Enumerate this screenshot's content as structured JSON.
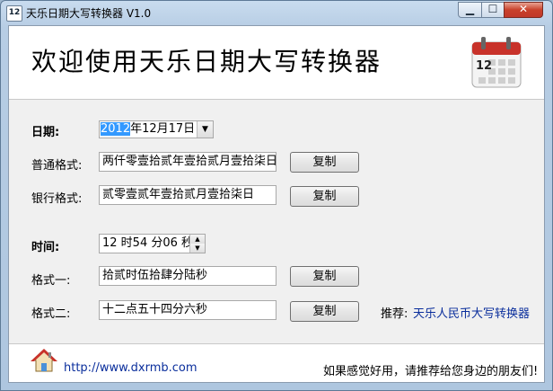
{
  "window": {
    "title": "天乐日期大写转换器 V1.0",
    "icon_text": "12",
    "min_icon": "minimize-icon",
    "max_icon": "maximize-icon",
    "close_icon": "close-icon"
  },
  "header": {
    "title": "欢迎使用天乐日期大写转换器",
    "calendar_icon": "calendar-icon",
    "calendar_number": "12"
  },
  "date_section": {
    "label": "日期:",
    "picker_year": "2012",
    "picker_rest": "年12月17日",
    "normal_label": "普通格式:",
    "normal_value": "两仟零壹拾贰年壹拾贰月壹拾柒日",
    "bank_label": "银行格式:",
    "bank_value": "贰零壹贰年壹拾贰月壹拾柒日",
    "copy_label": "复制"
  },
  "time_section": {
    "label": "时间:",
    "value": "12 时54 分06 秒",
    "format1_label": "格式一:",
    "format1_value": "拾贰时伍拾肆分陆秒",
    "format2_label": "格式二:",
    "format2_value": "十二点五十四分六秒",
    "copy_label": "复制"
  },
  "recommend": {
    "label": "推荐:",
    "link": "天乐人民币大写转换器"
  },
  "footer": {
    "url": "http://www.dxrmb.com",
    "message": "如果感觉好用，请推荐给您身边的朋友们!",
    "home_icon": "house-icon"
  },
  "colors": {
    "accent_selection": "#3399ff",
    "link": "#0a2e9c",
    "calendar_red": "#c8322a"
  }
}
